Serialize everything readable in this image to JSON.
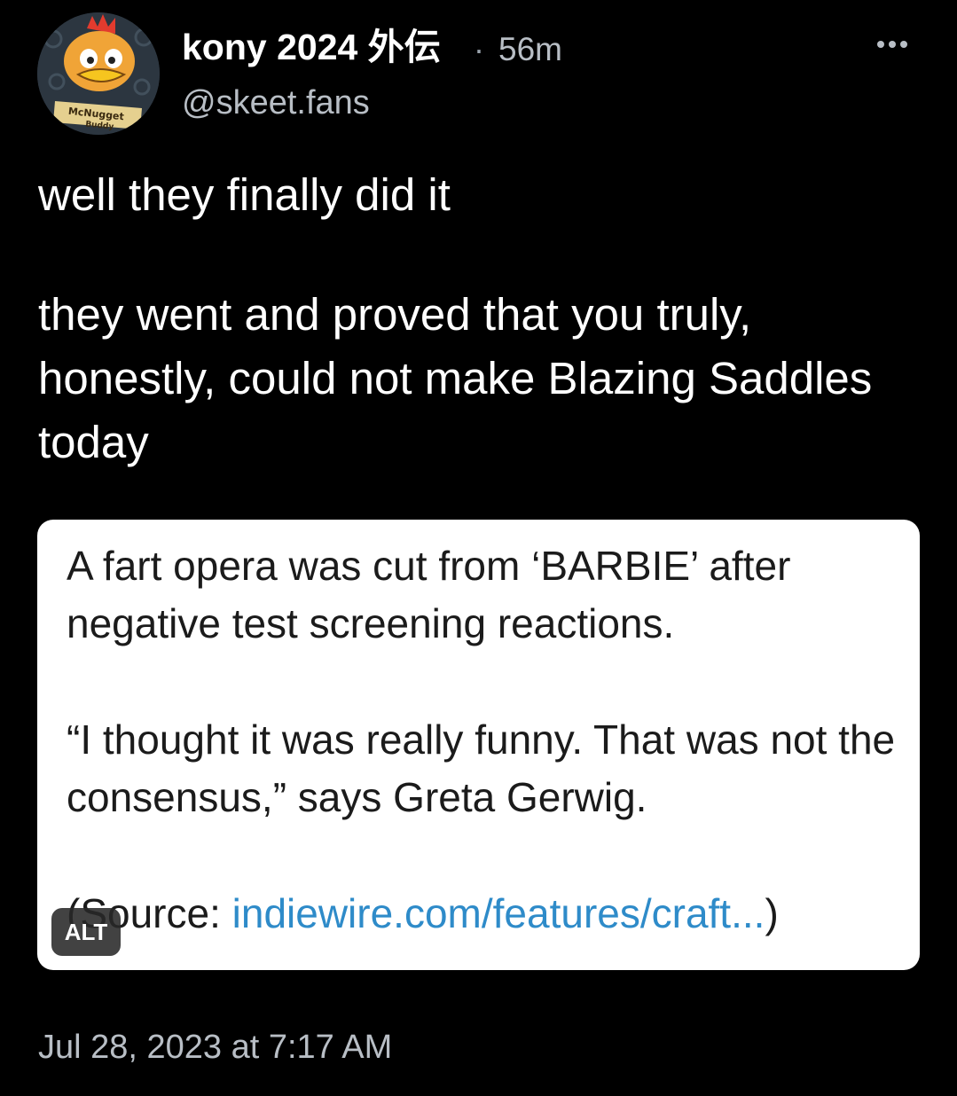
{
  "author": {
    "display_name": "kony 2024 外伝",
    "time_separator": "·",
    "time_ago": "56m",
    "handle": "@skeet.fans",
    "avatar_badge_text": "McNugget Buddy"
  },
  "post": {
    "paragraphs": [
      "well they finally did it",
      "they went and proved that you truly, honestly, could not make Blazing Saddles today"
    ],
    "timestamp": "Jul 28, 2023 at 7:17 AM"
  },
  "embed_image": {
    "headline": "A fart opera was cut from ‘BARBIE’ after negative test screening reactions.",
    "quote": "“I thought it was really funny. That was not the consensus,” says Greta Gerwig.",
    "source_prefix": "(Source: ",
    "source_link": "indiewire.com/features/craft...",
    "source_suffix": ")",
    "alt_badge": "ALT"
  },
  "icons": {
    "more": "more-horizontal-icon"
  },
  "colors": {
    "background": "#000000",
    "secondary_text": "#b8bec5",
    "link": "#2e8bc9"
  }
}
